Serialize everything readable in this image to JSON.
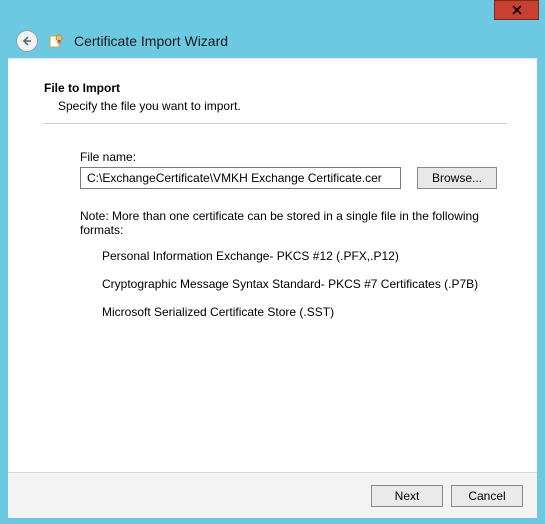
{
  "window": {
    "title": "Certificate Import Wizard"
  },
  "section": {
    "heading": "File to Import",
    "sub": "Specify the file you want to import."
  },
  "file": {
    "label": "File name:",
    "value": "C:\\ExchangeCertificate\\VMKH Exchange Certificate.cer",
    "browse": "Browse..."
  },
  "note": {
    "text": "Note:  More than one certificate can be stored in a single file in the following formats:",
    "formats": [
      "Personal Information Exchange- PKCS #12 (.PFX,.P12)",
      "Cryptographic Message Syntax Standard- PKCS #7 Certificates (.P7B)",
      "Microsoft Serialized Certificate Store (.SST)"
    ]
  },
  "buttons": {
    "next": "Next",
    "cancel": "Cancel"
  }
}
